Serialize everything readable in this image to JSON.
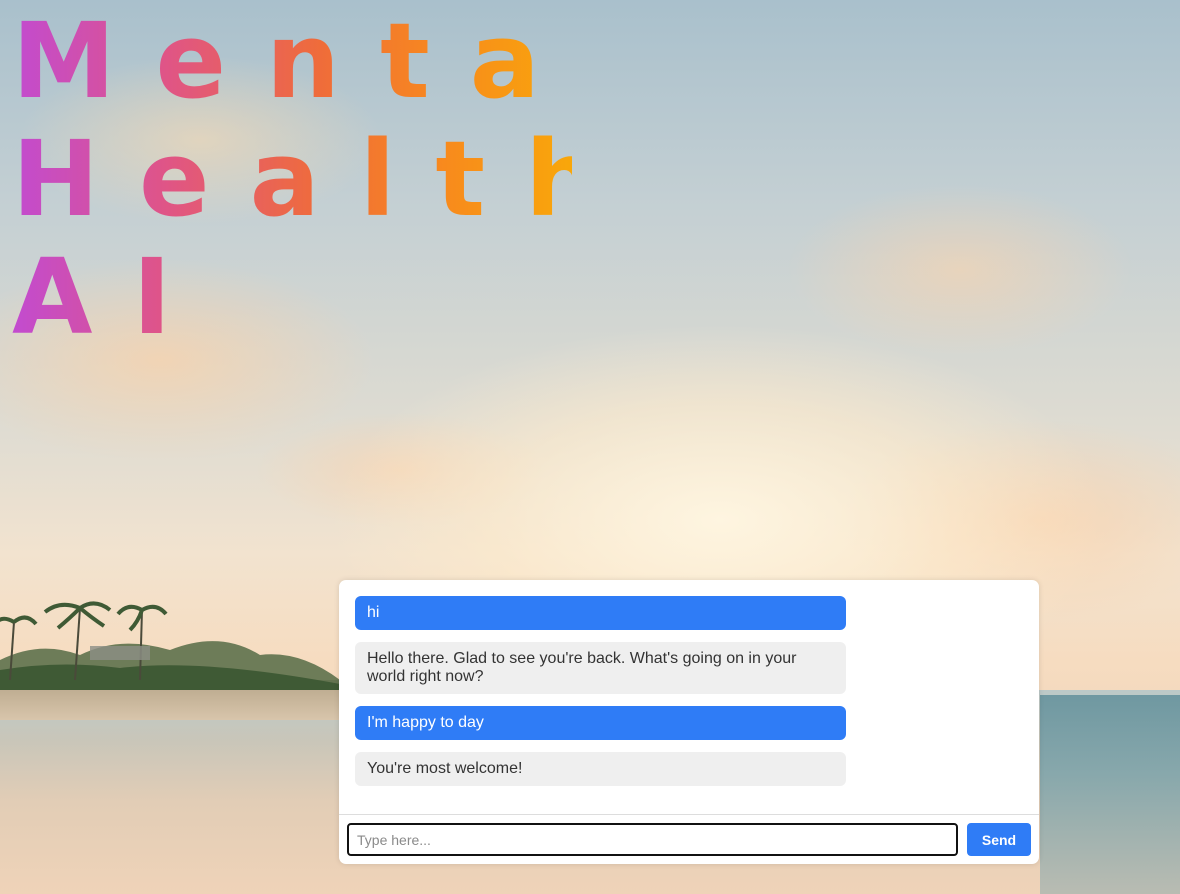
{
  "title": {
    "lines": [
      "Mental",
      "Health",
      "AI"
    ]
  },
  "chat": {
    "messages": [
      {
        "role": "user",
        "text": "hi"
      },
      {
        "role": "bot",
        "text": "Hello there. Glad to see you're back. What's going on in your world right now?"
      },
      {
        "role": "user",
        "text": "I'm happy to day"
      },
      {
        "role": "bot",
        "text": "You're most welcome!"
      }
    ],
    "input": {
      "value": "",
      "placeholder": "Type here..."
    },
    "send_label": "Send"
  },
  "colors": {
    "user_bubble": "#2f7cf6",
    "bot_bubble": "#efefef",
    "title_gradient": [
      "#c24bd0",
      "#e05585",
      "#ef6c3a",
      "#f88b1c",
      "#f9a70a"
    ]
  }
}
